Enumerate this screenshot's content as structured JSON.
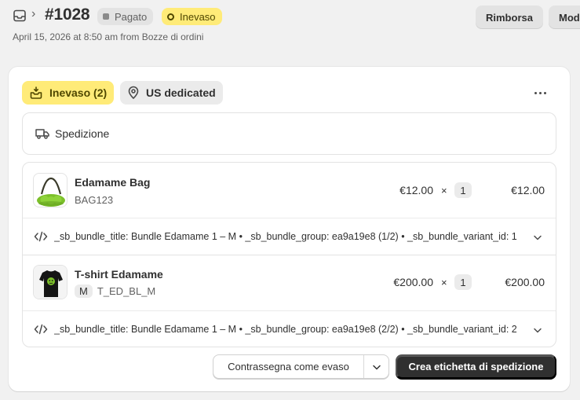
{
  "header": {
    "order_number": "#1028",
    "separator": "›",
    "badge_paid": "Pagato",
    "badge_unfulfilled": "Inevaso",
    "subtitle": "April 15, 2026 at 8:50 am from Bozze di ordini",
    "refund_label": "Rimborsa",
    "edit_label": "Modifica"
  },
  "fulfillment": {
    "status_label": "Inevaso (2)",
    "location_label": "US dedicated",
    "shipping_label": "Spedizione",
    "items": [
      {
        "name": "Edamame Bag",
        "sku": "BAG123",
        "variant": "",
        "unit_price": "€12.00",
        "times": "×",
        "quantity": "1",
        "total": "€12.00",
        "properties": "_sb_bundle_title: Bundle Edamame 1 – M • _sb_bundle_group: ea9a19e8 (1/2) • _sb_bundle_variant_id: 1"
      },
      {
        "name": "T-shirt Edamame",
        "sku": "T_ED_BL_M",
        "variant": "M",
        "unit_price": "€200.00",
        "times": "×",
        "quantity": "1",
        "total": "€200.00",
        "properties": "_sb_bundle_title: Bundle Edamame 1 – M • _sb_bundle_group: ea9a19e8 (2/2) • _sb_bundle_variant_id: 2"
      }
    ],
    "mark_fulfilled_label": "Contrassegna come evaso",
    "create_label_button": "Crea etichetta di spedizione"
  },
  "colors": {
    "attention_bg": "#ffeb78",
    "attention_text": "#4f4700",
    "primary_button": "#303030",
    "page_bg": "#f1f1f1"
  },
  "icons": {
    "orders": "orders-inbox-icon",
    "fulfillment": "package-fulfill-icon",
    "location": "location-pin-icon",
    "shipping": "delivery-truck-icon",
    "properties": "code-icon",
    "expand": "chevron-down-icon",
    "menu": "more-horizontal-icon"
  }
}
